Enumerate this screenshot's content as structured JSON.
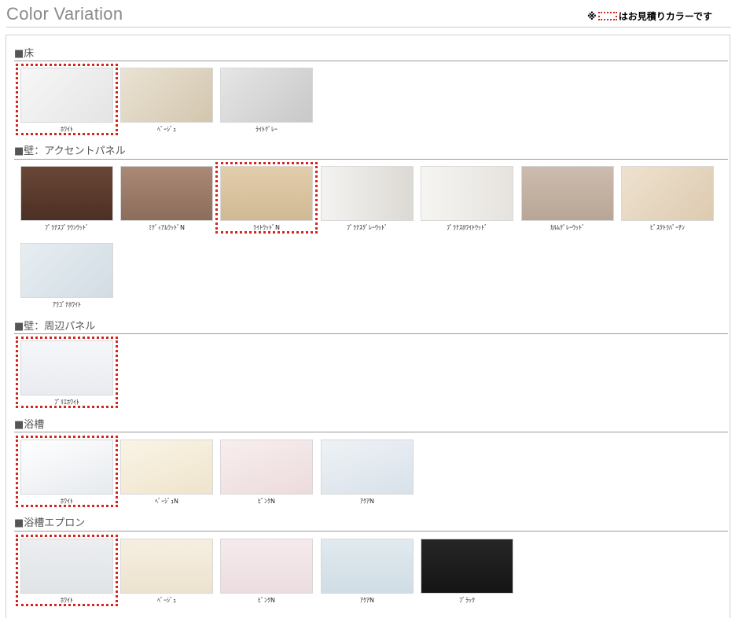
{
  "header": {
    "title": "Color Variation",
    "note_prefix": "※",
    "note_suffix": "はお見積りカラーです",
    "accent_color": "#d3261f"
  },
  "sections": [
    {
      "title": "■床",
      "items": [
        {
          "label": "ﾎﾜｲﾄ",
          "selected": true,
          "color": "#ececec"
        },
        {
          "label": "ﾍﾞｰｼﾞｭ",
          "selected": false,
          "color": "#ddd3c0"
        },
        {
          "label": "ﾗｲﾄｸﾞﾚｰ",
          "selected": false,
          "color": "#d6d6d6"
        }
      ]
    },
    {
      "title": "■壁：アクセントパネル",
      "items": [
        {
          "label": "ﾌﾟﾗﾅｽﾌﾞﾗｳﾝｳｯﾄﾞ",
          "selected": false,
          "color": "#5a3a2c"
        },
        {
          "label": "ﾐﾃﾞｨｱﾑｳｯﾄﾞN",
          "selected": false,
          "color": "#9c7c69"
        },
        {
          "label": "ﾗｲﾄｳｯﾄﾞN",
          "selected": true,
          "color": "#d8c2a0"
        },
        {
          "label": "ﾌﾟﾗﾅｽｸﾞﾚｰｳｯﾄﾞ",
          "selected": false,
          "color": "#e6e3de"
        },
        {
          "label": "ﾌﾟﾗﾅｽﾎﾜｲﾄｳｯﾄﾞ",
          "selected": false,
          "color": "#eeece8"
        },
        {
          "label": "ｶﾙﾑｸﾞﾚｰｳｯﾄﾞ",
          "selected": false,
          "color": "#c4b2a4"
        },
        {
          "label": "ﾋﾞｽｸﾄﾗﾊﾞｰﾁﾝ",
          "selected": false,
          "color": "#e7d8c4"
        },
        {
          "label": "ｱﾗｺﾞﾅﾎﾜｲﾄ",
          "selected": false,
          "color": "#dde5eb"
        }
      ]
    },
    {
      "title": "■壁：周辺パネル",
      "items": [
        {
          "label": "ﾌﾟﾘｴﾎﾜｲﾄ",
          "selected": true,
          "color": "#f1f2f6"
        }
      ]
    },
    {
      "title": "■浴槽",
      "items": [
        {
          "label": "ﾎﾜｲﾄ",
          "selected": true,
          "color": "#eef1f4"
        },
        {
          "label": "ﾍﾞｰｼﾞｭN",
          "selected": false,
          "color": "#f2ead8"
        },
        {
          "label": "ﾋﾟﾝｸN",
          "selected": false,
          "color": "#f1e2e3"
        },
        {
          "label": "ｱｸｱN",
          "selected": false,
          "color": "#e1e8ee"
        }
      ]
    },
    {
      "title": "■浴槽エプロン",
      "items": [
        {
          "label": "ﾎﾜｲﾄ",
          "selected": true,
          "color": "#e6e9ec"
        },
        {
          "label": "ﾍﾞｰｼﾞｭ",
          "selected": false,
          "color": "#f1e9d9"
        },
        {
          "label": "ﾋﾟﾝｸN",
          "selected": false,
          "color": "#f2e4e6"
        },
        {
          "label": "ｱｸｱN",
          "selected": false,
          "color": "#d8e4ea"
        },
        {
          "label": "ﾌﾞﾗｯｸ",
          "selected": false,
          "color": "#1c1c1c"
        }
      ]
    }
  ]
}
